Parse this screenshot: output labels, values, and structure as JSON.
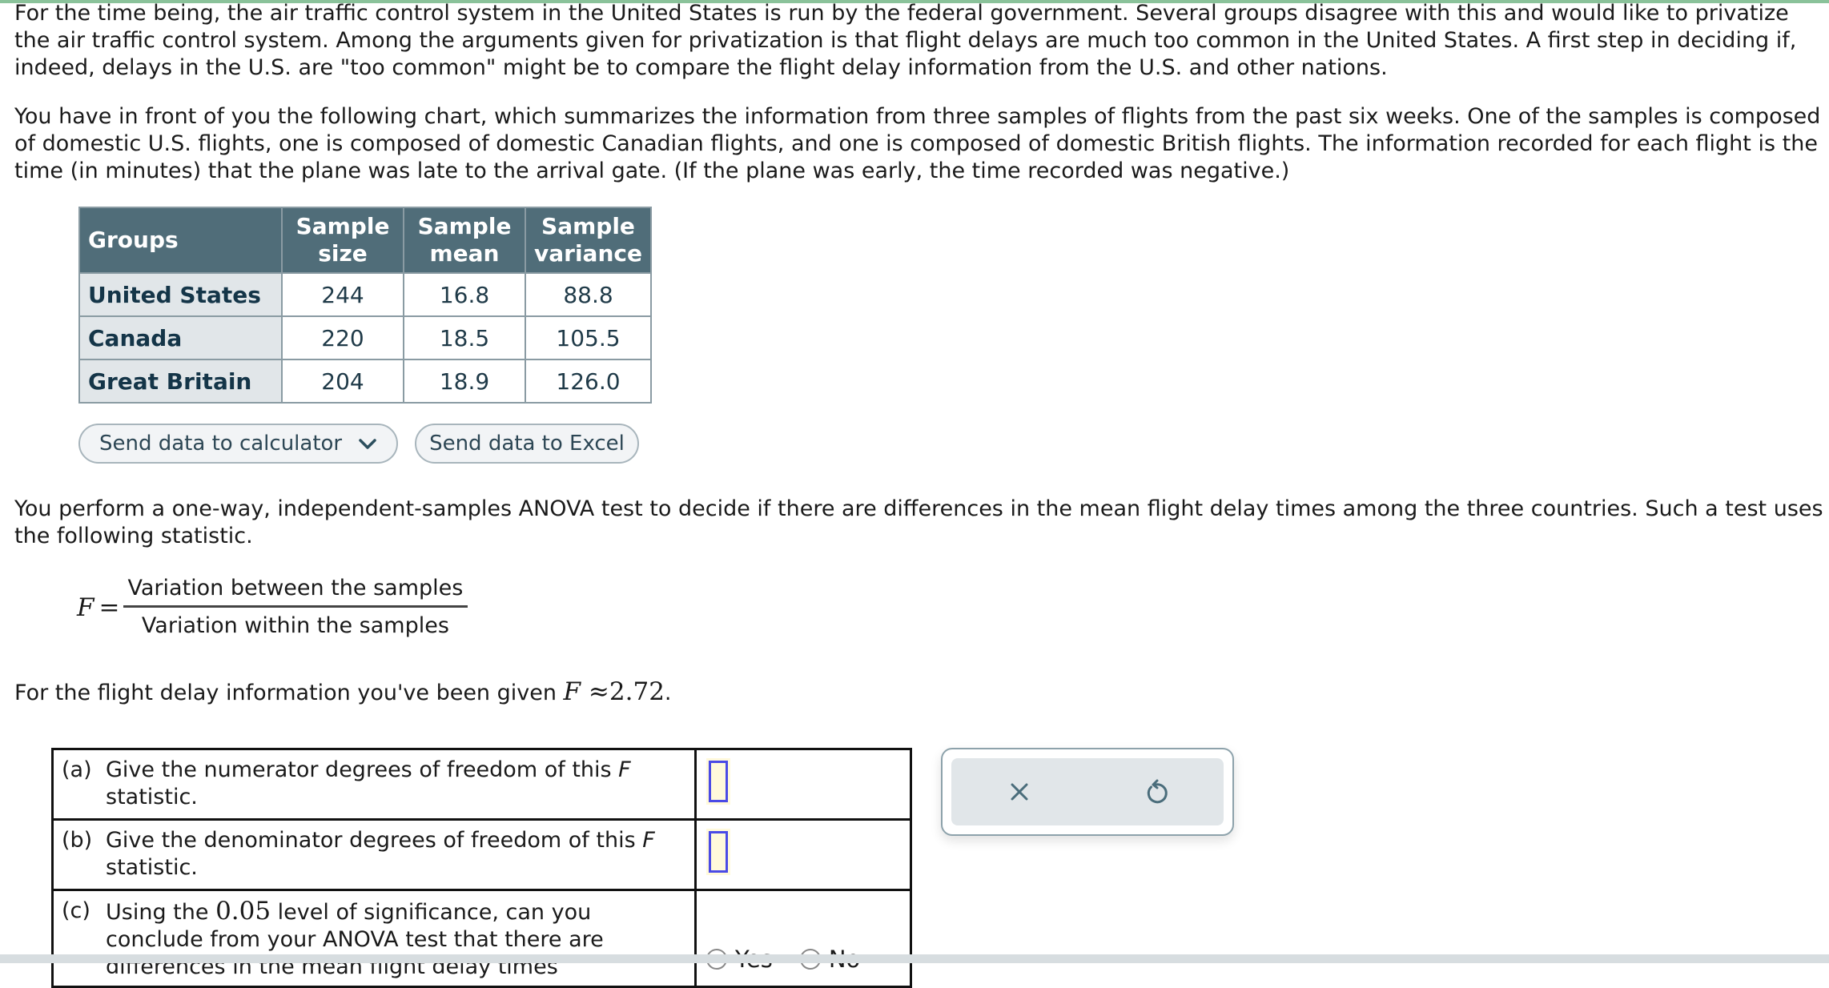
{
  "intro": {
    "paragraph1": "For the time being, the air traffic control system in the United States is run by the federal government. Several groups disagree with this and would like to privatize the air traffic control system. Among the arguments given for privatization is that flight delays are much too common in the United States. A first step in deciding if, indeed, delays in the U.S. are \"too common\" might be to compare the flight delay information from the U.S. and other nations.",
    "paragraph2": "You have in front of you the following chart, which summarizes the information from three samples of flights from the past six weeks. One of the samples is composed of domestic U.S. flights, one is composed of domestic Canadian flights, and one is composed of domestic British flights. The information recorded for each flight is the time (in minutes) that the plane was late to the arrival gate. (If the plane was early, the time recorded was negative.)"
  },
  "table": {
    "headers": [
      "Groups",
      "Sample size",
      "Sample mean",
      "Sample variance"
    ],
    "rows": [
      {
        "group": "United States",
        "size": "244",
        "mean": "16.8",
        "variance": "88.8"
      },
      {
        "group": "Canada",
        "size": "220",
        "mean": "18.5",
        "variance": "105.5"
      },
      {
        "group": "Great Britain",
        "size": "204",
        "mean": "18.9",
        "variance": "126.0"
      }
    ]
  },
  "buttons": {
    "calculator": "Send data to calculator",
    "excel": "Send data to Excel"
  },
  "anova": {
    "paragraph": "You perform a one-way, independent-samples ANOVA test to decide if there are differences in the mean flight delay times among the three countries. Such a test uses the following statistic.",
    "f_symbol": "F",
    "equals": "=",
    "numerator": "Variation between the samples",
    "denominator": "Variation within the samples",
    "given_prefix": "For the flight delay information you've been given ",
    "given_symbol": "F",
    "given_value": " ≈2.72",
    "given_suffix": "."
  },
  "questions": [
    {
      "label": "(a)",
      "text_before": "Give the numerator degrees of freedom of this ",
      "italic": "F",
      "text_after": " statistic.",
      "answer": ""
    },
    {
      "label": "(b)",
      "text_before": "Give the denominator degrees of freedom of this ",
      "italic": "F",
      "text_after": " statistic.",
      "answer": ""
    },
    {
      "label": "(c)",
      "text_before": "Using the ",
      "math": "0.05",
      "text_after": " level of significance, can you conclude from your ANOVA test that there are differences in the mean flight delay times",
      "options": [
        "Yes",
        "No"
      ]
    }
  ],
  "tools": {
    "clear": "clear-x",
    "reset": "undo-reset"
  }
}
